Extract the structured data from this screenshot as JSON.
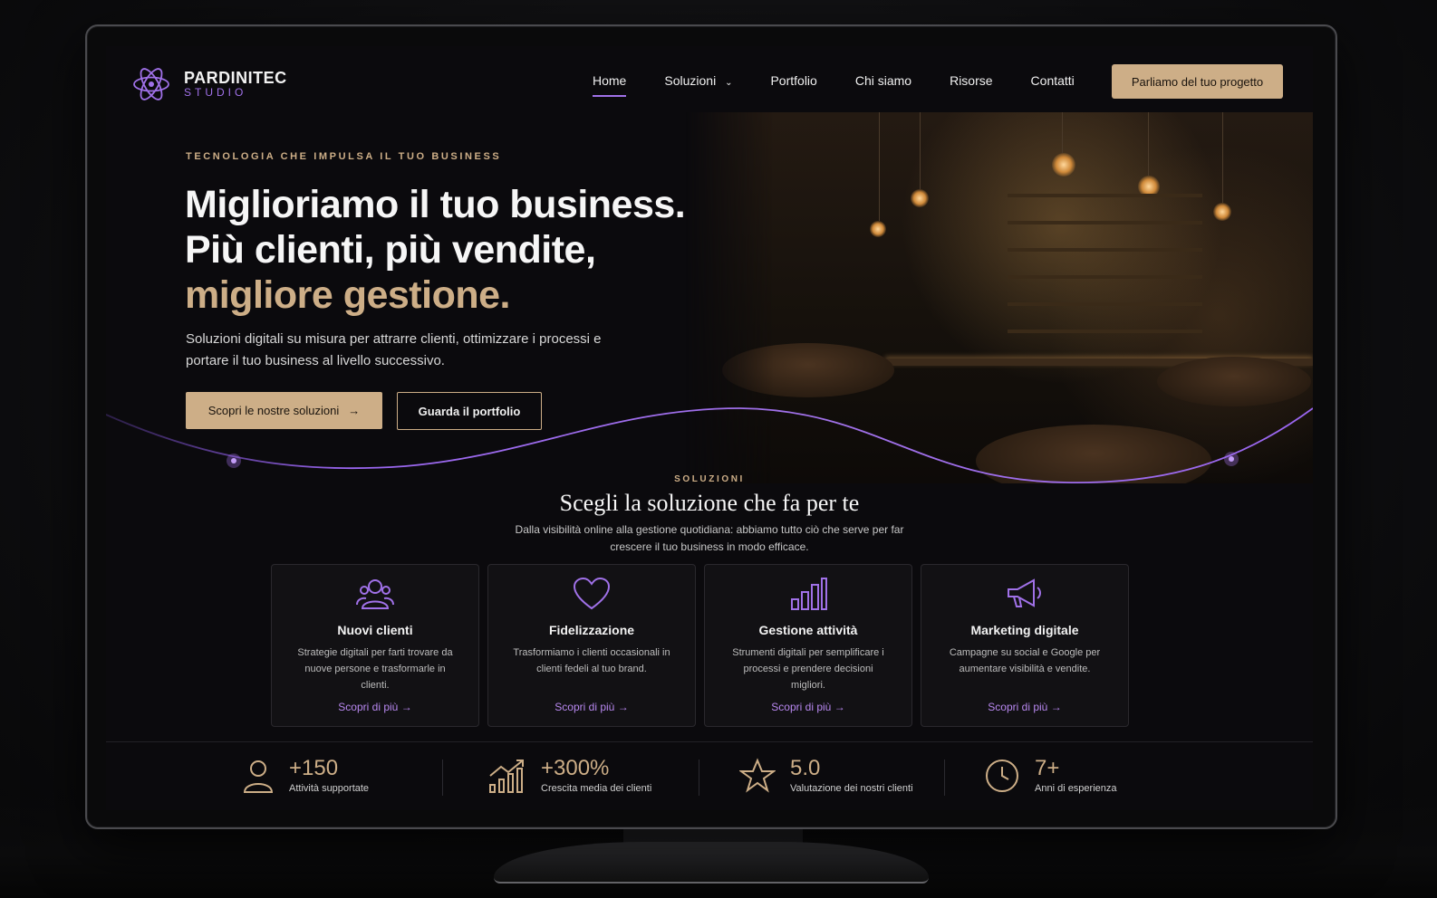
{
  "brand": {
    "name": "PARDINITEC",
    "sub": "STUDIO"
  },
  "nav": {
    "items": [
      {
        "label": "Home",
        "active": true
      },
      {
        "label": "Soluzioni",
        "dropdown": true
      },
      {
        "label": "Portfolio"
      },
      {
        "label": "Chi siamo"
      },
      {
        "label": "Risorse"
      },
      {
        "label": "Contatti"
      }
    ],
    "cta": "Parliamo del tuo progetto"
  },
  "hero": {
    "eyebrow": "TECNOLOGIA CHE IMPULSA IL TUO BUSINESS",
    "line1": "Miglioriamo il tuo business.",
    "line2": "Più clienti, più vendite,",
    "line3": "migliore gestione.",
    "subtitle": "Soluzioni digitali su misura per attrarre clienti, ottimizzare i processi e portare il tuo business al livello successivo.",
    "primary_btn": "Scopri le nostre soluzioni",
    "secondary_btn": "Guarda il portfolio"
  },
  "solutions": {
    "eyebrow": "SOLUZIONI",
    "title": "Scegli la soluzione che fa per te",
    "subtitle": "Dalla visibilità online alla gestione quotidiana: abbiamo tutto ciò che serve per far crescere il tuo business in modo efficace.",
    "cards": [
      {
        "icon": "users-icon",
        "title": "Nuovi clienti",
        "desc": "Strategie digitali per farti trovare da nuove persone e trasformarle in clienti.",
        "link": "Scopri di più"
      },
      {
        "icon": "heart-icon",
        "title": "Fidelizzazione",
        "desc": "Trasformiamo i clienti occasionali in clienti fedeli al tuo brand.",
        "link": "Scopri di più"
      },
      {
        "icon": "bar-chart-icon",
        "title": "Gestione attività",
        "desc": "Strumenti digitali per semplificare i processi e prendere decisioni migliori.",
        "link": "Scopri di più"
      },
      {
        "icon": "megaphone-icon",
        "title": "Marketing digitale",
        "desc": "Campagne su social e Google per aumentare visibilità e vendite.",
        "link": "Scopri di più"
      }
    ]
  },
  "stats": [
    {
      "icon": "user-icon",
      "value": "+150",
      "label": "Attività supportate"
    },
    {
      "icon": "growth-chart-icon",
      "value": "+300%",
      "label": "Crescita media dei clienti"
    },
    {
      "icon": "star-icon",
      "value": "5.0",
      "label": "Valutazione dei nostri clienti"
    },
    {
      "icon": "clock-icon",
      "value": "7+",
      "label": "Anni di esperienza"
    }
  ],
  "colors": {
    "accent_gold": "#cdae87",
    "accent_purple": "#a071e8",
    "bg": "#0b0a0d"
  }
}
